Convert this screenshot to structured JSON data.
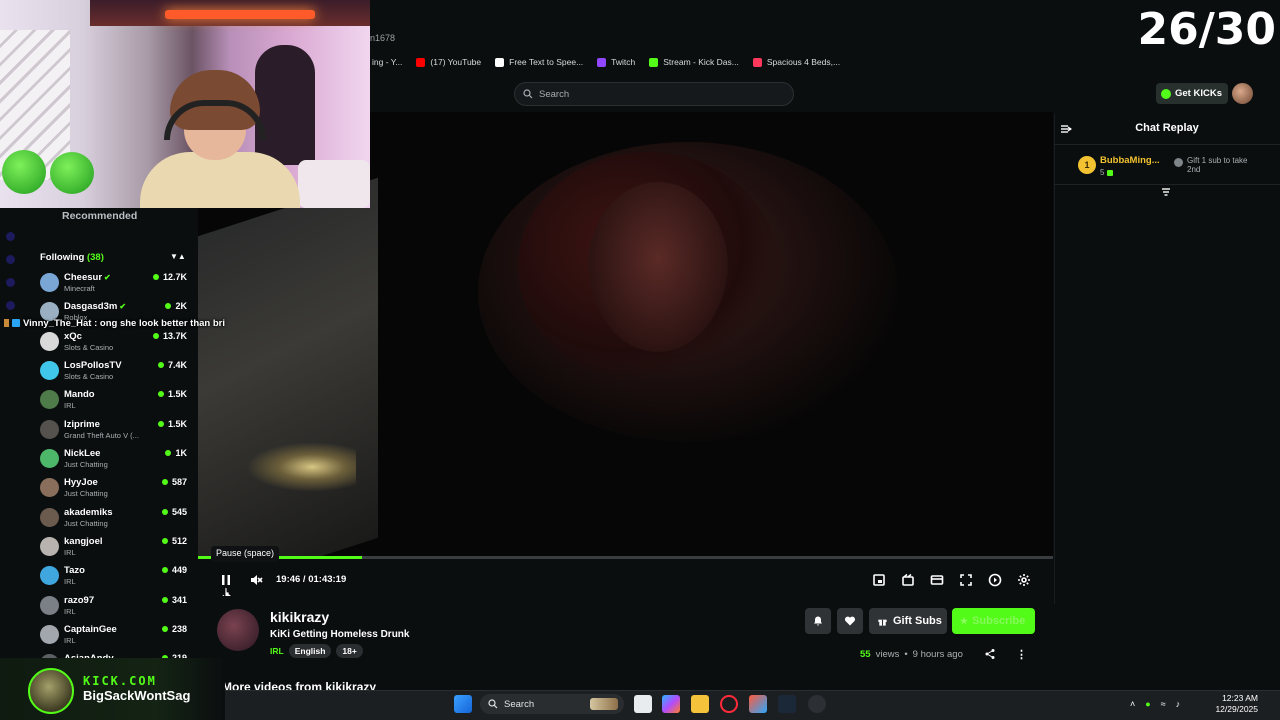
{
  "browser": {
    "tab_fragment": "n1678",
    "bookmarks": [
      {
        "label": "ing - Y...",
        "color": "#ff3b3b"
      },
      {
        "label": "(17) YouTube",
        "color": "#ff0000"
      },
      {
        "label": "Free Text to Spee...",
        "color": "#ffffff"
      },
      {
        "label": "Twitch",
        "color": "#9146ff"
      },
      {
        "label": "Stream - Kick Das...",
        "color": "#53fc18"
      },
      {
        "label": "Spacious 4 Beds,...",
        "color": "#ff385c"
      }
    ],
    "search_placeholder": "Search"
  },
  "overlay": {
    "counter": "26/30",
    "chat_message": "Vinny_The_Hat : ong she look better than bri",
    "bottom_brand": "KICK.COM",
    "bottom_name": "BigSackWontSag"
  },
  "header": {
    "get_kicks_label": "Get KICKs"
  },
  "sidebar": {
    "recommended_label": "Recommended",
    "following_label": "Following",
    "following_count": "(38)",
    "channels": [
      {
        "name": "Cheesur",
        "category": "Minecraft",
        "viewers": "12.7K",
        "verified": true,
        "color": "#7aa6d6"
      },
      {
        "name": "Dasgasd3m",
        "category": "Roblox",
        "viewers": "2K",
        "verified": true,
        "color": "#9ab0c2"
      },
      {
        "name": "xQc",
        "category": "Slots & Casino",
        "viewers": "13.7K",
        "verified": false,
        "color": "#d9d9d9"
      },
      {
        "name": "LosPollosTV",
        "category": "Slots & Casino",
        "viewers": "7.4K",
        "verified": false,
        "color": "#3fc6ea"
      },
      {
        "name": "Mando",
        "category": "IRL",
        "viewers": "1.5K",
        "verified": false,
        "color": "#4f7a49"
      },
      {
        "name": "Iziprime",
        "category": "Grand Theft Auto V (...",
        "viewers": "1.5K",
        "verified": false,
        "color": "#55524d"
      },
      {
        "name": "NickLee",
        "category": "Just Chatting",
        "viewers": "1K",
        "verified": false,
        "color": "#4db86a"
      },
      {
        "name": "HyyJoe",
        "category": "Just Chatting",
        "viewers": "587",
        "verified": false,
        "color": "#8a6e5c"
      },
      {
        "name": "akademiks",
        "category": "Just Chatting",
        "viewers": "545",
        "verified": false,
        "color": "#6b5a4e"
      },
      {
        "name": "kangjoel",
        "category": "IRL",
        "viewers": "512",
        "verified": false,
        "color": "#b8b3ae"
      },
      {
        "name": "Tazo",
        "category": "IRL",
        "viewers": "449",
        "verified": false,
        "color": "#3fa7de"
      },
      {
        "name": "razo97",
        "category": "IRL",
        "viewers": "341",
        "verified": false,
        "color": "#7b7f86"
      },
      {
        "name": "CaptainGee",
        "category": "IRL",
        "viewers": "238",
        "verified": false,
        "color": "#a2a7ad"
      },
      {
        "name": "AsianAndy",
        "category": "",
        "viewers": "219",
        "verified": false,
        "color": "#5c5f63"
      }
    ]
  },
  "player": {
    "tooltip": "Pause (space)",
    "time": "19:46 / 01:43:19",
    "progress": 0.1914
  },
  "stream": {
    "streamer": "kikikrazy",
    "title": "KiKi Getting Homeless Drunk",
    "category": "IRL",
    "tags": [
      "English",
      "18+"
    ],
    "gift_subs_label": "Gift Subs",
    "subscribe_label": "Subscribe",
    "views_count": "55",
    "views_label": "views",
    "separator": "•",
    "posted": "9 hours ago",
    "more_videos": "More videos from kikikrazy"
  },
  "chat": {
    "title": "Chat Replay",
    "top_gifter": {
      "rank": "1",
      "name": "BubbaMing...",
      "count": "5",
      "gift_text": "Gift 1 sub to take 2nd"
    }
  },
  "taskbar": {
    "search_label": "Search",
    "time": "12:23 AM",
    "date": "12/29/2025"
  }
}
